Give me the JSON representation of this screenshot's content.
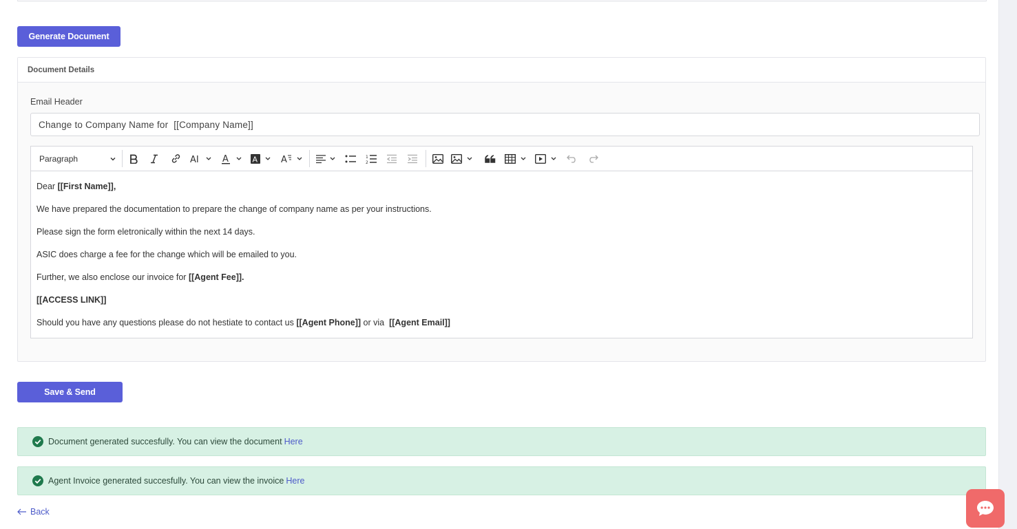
{
  "actions": {
    "generate_label": "Generate Document",
    "save_send_label": "Save & Send",
    "back_label": "Back"
  },
  "card": {
    "title": "Document Details",
    "email_header_label": "Email Header",
    "email_header_value": "Change to Company Name for  [[Company Name]]"
  },
  "toolbar": {
    "paragraph_select": "Paragraph",
    "icons": [
      "bold-icon",
      "italic-icon",
      "link-icon",
      "font-size-icon",
      "font-color-icon",
      "highlight-icon",
      "text-style-icon",
      "align-icon",
      "bullet-list-icon",
      "numbered-list-icon",
      "outdent-icon",
      "indent-icon",
      "image-icon",
      "insert-image-icon",
      "blockquote-icon",
      "table-icon",
      "media-icon",
      "undo-icon",
      "redo-icon"
    ]
  },
  "body": {
    "greeting_text": "Dear ",
    "greeting_field": "[[First Name]],",
    "line1": "We have prepared the documentation to prepare the change of company name as per your instructions.",
    "line2": "Please sign the form eletronically within the next 14 days.",
    "line3": "ASIC does charge a fee for the change which will be emailed to you.",
    "line4_text": "Further, we also enclose our invoice for ",
    "line4_field": "[[Agent Fee]].",
    "access_link": "[[ACCESS LINK]]",
    "line6_text": "Should you have any questions please do not hestiate to contact us ",
    "line6_phone": "[[Agent Phone]]",
    "line6_mid": " or via  ",
    "line6_email": "[[Agent Email]]"
  },
  "alerts": [
    {
      "text": "Document generated succesfully. You can view the document",
      "link": "Here"
    },
    {
      "text": "Agent Invoice generated succesfully. You can view the invoice",
      "link": "Here"
    }
  ],
  "colors": {
    "primary": "#5a5fd9",
    "success_bg": "#d7f1e4",
    "success_icon": "#1f7a4d",
    "link": "#4d5bc9",
    "chat": "#f06a6a"
  }
}
